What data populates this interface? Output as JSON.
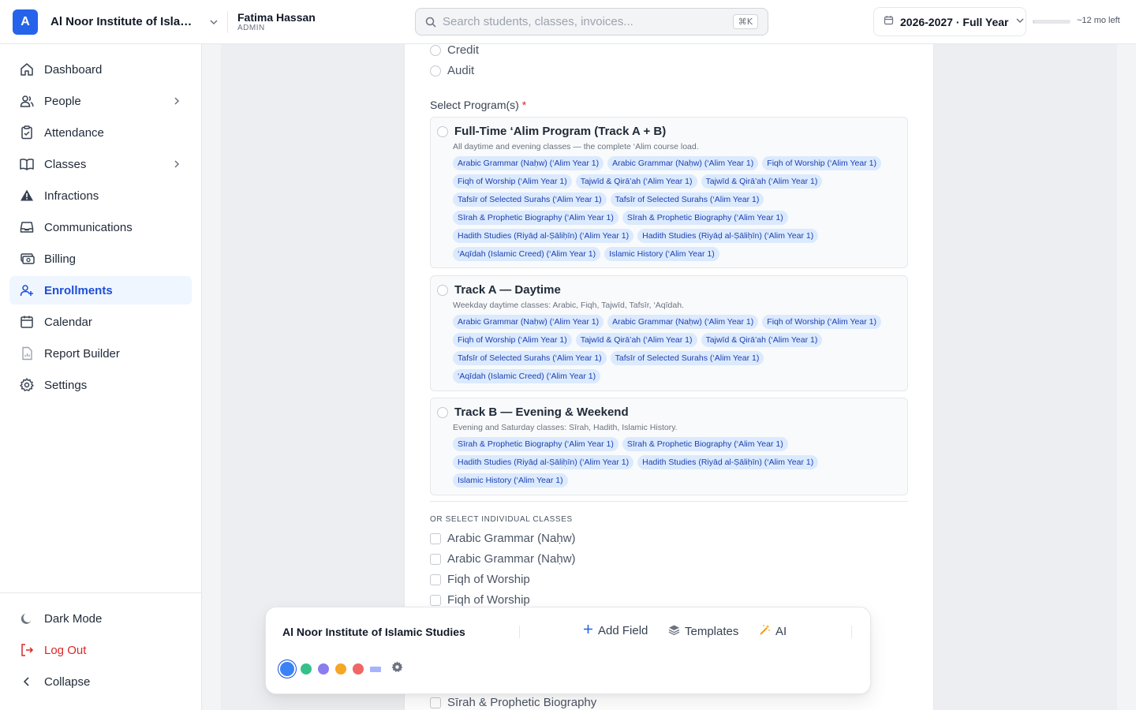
{
  "header": {
    "org_initial": "A",
    "org_name": "Al Noor Institute of Islamic...",
    "user_name": "Fatima Hassan",
    "user_role": "ADMIN",
    "search_placeholder": "Search students, classes, invoices...",
    "search_shortcut": "⌘K",
    "year_label": "2026-2027 · Full Year",
    "year_progress_percent": 4,
    "remaining": "~12 mo left"
  },
  "sidebar": {
    "items": [
      {
        "label": "Dashboard",
        "icon": "home-icon"
      },
      {
        "label": "People",
        "icon": "users-icon"
      },
      {
        "label": "Attendance",
        "icon": "clipboard-check-icon"
      },
      {
        "label": "Classes",
        "icon": "book-icon"
      },
      {
        "label": "Infractions",
        "icon": "warning-icon"
      },
      {
        "label": "Communications",
        "icon": "inbox-icon"
      },
      {
        "label": "Billing",
        "icon": "billing-icon"
      },
      {
        "label": "Enrollments",
        "icon": "user-plus-icon"
      },
      {
        "label": "Calendar",
        "icon": "calendar-icon"
      },
      {
        "label": "Report Builder",
        "icon": "report-icon"
      },
      {
        "label": "Settings",
        "icon": "gear-icon"
      }
    ],
    "bottom": {
      "dark_mode": "Dark Mode",
      "logout": "Log Out",
      "collapse": "Collapse"
    }
  },
  "form": {
    "enrollment_options": [
      "Credit",
      "Audit"
    ],
    "programs_label": "Select Program(s)",
    "required_mark": "*",
    "programs": [
      {
        "title": "Full-Time ‘Alim Program (Track A + B)",
        "description": "All daytime and evening classes — the complete ‘Alim course load.",
        "classes": [
          "Arabic Grammar (Naḥw) (‘Alim Year 1)",
          "Arabic Grammar (Naḥw) (‘Alim Year 1)",
          "Fiqh of Worship (‘Alim Year 1)",
          "Fiqh of Worship (‘Alim Year 1)",
          "Tajwīd & Qirā’ah (‘Alim Year 1)",
          "Tajwīd & Qirā’ah (‘Alim Year 1)",
          "Tafsīr of Selected Surahs (‘Alim Year 1)",
          "Tafsīr of Selected Surahs (‘Alim Year 1)",
          "Sīrah & Prophetic Biography (‘Alim Year 1)",
          "Sīrah & Prophetic Biography (‘Alim Year 1)",
          "Hadith Studies (Riyāḍ al-Ṣāliḥīn) (‘Alim Year 1)",
          "Hadith Studies (Riyāḍ al-Ṣāliḥīn) (‘Alim Year 1)",
          "‘Aqīdah (Islamic Creed) (‘Alim Year 1)",
          "Islamic History (‘Alim Year 1)"
        ]
      },
      {
        "title": "Track A — Daytime",
        "description": "Weekday daytime classes: Arabic, Fiqh, Tajwīd, Tafsīr, ‘Aqīdah.",
        "classes": [
          "Arabic Grammar (Naḥw) (‘Alim Year 1)",
          "Arabic Grammar (Naḥw) (‘Alim Year 1)",
          "Fiqh of Worship (‘Alim Year 1)",
          "Fiqh of Worship (‘Alim Year 1)",
          "Tajwīd & Qirā’ah (‘Alim Year 1)",
          "Tajwīd & Qirā’ah (‘Alim Year 1)",
          "Tafsīr of Selected Surahs (‘Alim Year 1)",
          "Tafsīr of Selected Surahs (‘Alim Year 1)",
          "‘Aqīdah (Islamic Creed) (‘Alim Year 1)"
        ]
      },
      {
        "title": "Track B — Evening & Weekend",
        "description": "Evening and Saturday classes: Sīrah, Hadith, Islamic History.",
        "classes": [
          "Sīrah & Prophetic Biography (‘Alim Year 1)",
          "Sīrah & Prophetic Biography (‘Alim Year 1)",
          "Hadith Studies (Riyāḍ al-Ṣāliḥīn) (‘Alim Year 1)",
          "Hadith Studies (Riyāḍ al-Ṣāliḥīn) (‘Alim Year 1)",
          "Islamic History (‘Alim Year 1)"
        ]
      }
    ],
    "individual_label": "OR SELECT INDIVIDUAL CLASSES",
    "individual_classes": [
      "Arabic Grammar (Naḥw)",
      "Arabic Grammar (Naḥw)",
      "Fiqh of Worship",
      "Fiqh of Worship",
      "Sīrah & Prophetic Biography"
    ]
  },
  "toolbar": {
    "title": "Al Noor Institute of Islamic Studies",
    "add_field": "Add Field",
    "templates": "Templates",
    "ai": "AI",
    "swatches": [
      "#3b82f6",
      "#34c28a",
      "#8b7cf0",
      "#f5a623",
      "#f06565"
    ]
  }
}
